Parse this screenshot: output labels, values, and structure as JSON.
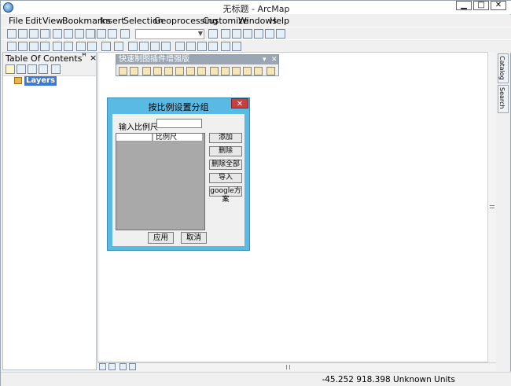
{
  "window": {
    "title": "无标题 - ArcMap",
    "min_label": "▁",
    "max_label": "□",
    "close_label": "✕"
  },
  "menu": [
    "File",
    "Edit",
    "View",
    "Bookmarks",
    "Insert",
    "Selection",
    "Geoprocessing",
    "Customize",
    "Windows",
    "Help"
  ],
  "toc": {
    "title": "Table Of Contents",
    "pin": "ꟸ",
    "close": "×",
    "layers_label": "Layers"
  },
  "right_dock": {
    "tabs": [
      "Catalog",
      "Search"
    ]
  },
  "floating_toolbar": {
    "title": "快速制图插件增强版"
  },
  "dialog": {
    "title": "按比例设置分组",
    "close_label": "✕",
    "scale_label": "输入比例尺",
    "scale_value": "",
    "grid_column_header": "比例尺",
    "buttons": [
      "添加",
      "删除",
      "删除全部",
      "导入",
      "google方案"
    ],
    "apply_label": "应用",
    "cancel_label": "取消"
  },
  "status": {
    "coords": "-45.252  918.398 Unknown Units"
  },
  "colors": {
    "dialog_frame": "#5bbae3",
    "dialog_close": "#c64040",
    "layers_highlight": "#3a79d6",
    "float_title": "#9aa6b3"
  }
}
